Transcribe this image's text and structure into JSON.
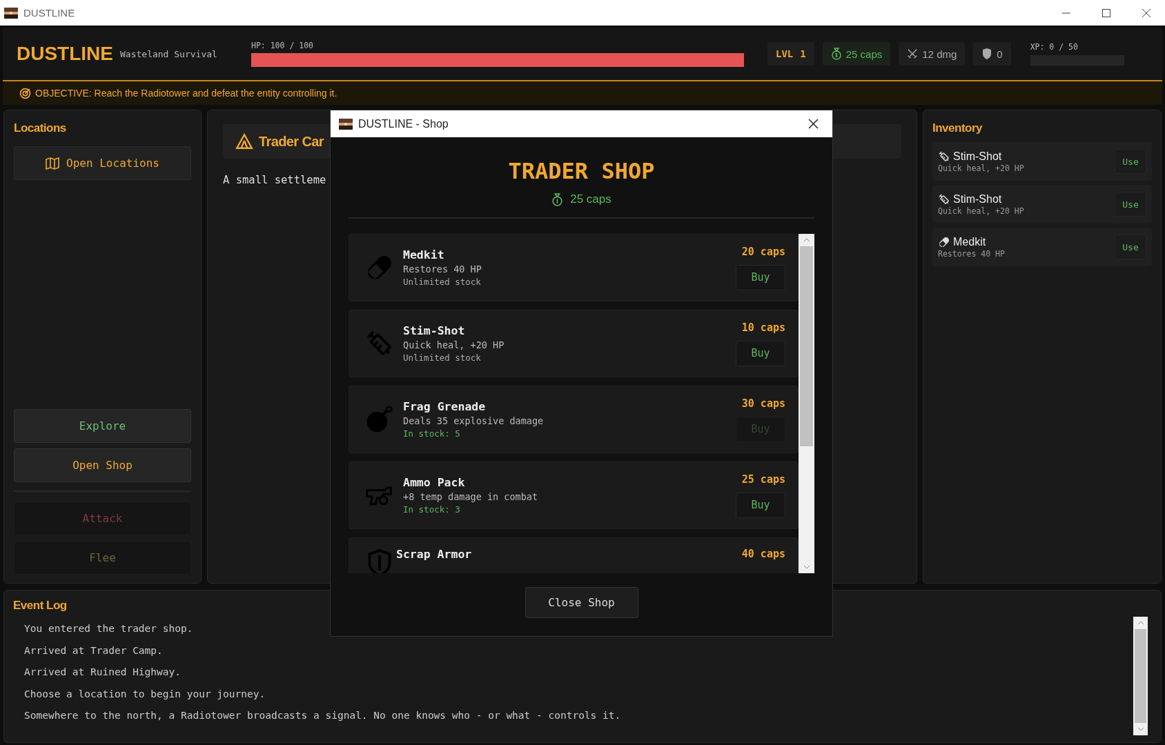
{
  "window": {
    "title": "DUSTLINE"
  },
  "header": {
    "logo": "DUSTLINE",
    "subtitle": "Wasteland Survival",
    "hp": {
      "label": "HP: 100 / 100",
      "level": 1
    },
    "rank": {
      "label": "LVL",
      "value": "1"
    },
    "caps": "25 caps",
    "damage": "12 dmg",
    "armor": "0",
    "xp": {
      "label": "XP: 0 / 50",
      "level": 0
    }
  },
  "objective": "OBJECTIVE: Reach the Radiotower and defeat the entity controlling it.",
  "locations": {
    "title": "Locations",
    "open_button": "Open Locations",
    "actions": [
      {
        "label": "Explore",
        "color": "#6dbf73",
        "disabled": false
      },
      {
        "label": "Open Shop",
        "color": "#f0a830",
        "disabled": false
      }
    ],
    "combat_actions": [
      {
        "label": "Attack",
        "color": "#7d3a3a",
        "disabled": true
      },
      {
        "label": "Flee",
        "color": "#75613a",
        "disabled": true
      }
    ]
  },
  "location": {
    "title": "Trader Car",
    "description": "A small settleme"
  },
  "shop": {
    "title": "DUSTLINE - Shop",
    "heading": "TRADER SHOP",
    "caps": "25 caps",
    "items": [
      {
        "kind": "medkit",
        "name": "Medkit",
        "description": "Restores 40 HP",
        "stock": "Unlimited stock",
        "limited": false,
        "price": "20 caps",
        "buy": "Buy",
        "disabled": false
      },
      {
        "kind": "stim",
        "name": "Stim-Shot",
        "description": "Quick heal, +20 HP",
        "stock": "Unlimited stock",
        "limited": false,
        "price": "10 caps",
        "buy": "Buy",
        "disabled": false
      },
      {
        "kind": "grenade",
        "name": "Frag Grenade",
        "description": "Deals 35 explosive damage",
        "stock": "In stock: 5",
        "limited": true,
        "price": "30 caps",
        "buy": "Buy",
        "disabled": true
      },
      {
        "kind": "ammo",
        "name": "Ammo Pack",
        "description": "+8 temp damage in combat",
        "stock": "In stock: 3",
        "limited": true,
        "price": "25 caps",
        "buy": "Buy",
        "disabled": false
      },
      {
        "kind": "armor",
        "name": "Scrap Armor",
        "price": "40 caps"
      }
    ],
    "close_button": "Close Shop"
  },
  "inventory": {
    "title": "Inventory",
    "items": [
      {
        "kind": "stim",
        "name": "Stim-Shot",
        "description": "Quick heal, +20 HP",
        "action": "Use"
      },
      {
        "kind": "stim",
        "name": "Stim-Shot",
        "description": "Quick heal, +20 HP",
        "action": "Use"
      },
      {
        "kind": "medkit",
        "name": "Medkit",
        "description": "Restores 40 HP",
        "action": "Use"
      }
    ]
  },
  "event_log": {
    "title": "Event Log",
    "entries": [
      "You entered the trader shop.",
      "Arrived at Trader Camp.",
      "Arrived at Ruined Highway.",
      "Choose a location to begin your journey.",
      "Somewhere to the north, a Radiotower broadcasts a signal. No one knows who - or what - controls it."
    ]
  }
}
